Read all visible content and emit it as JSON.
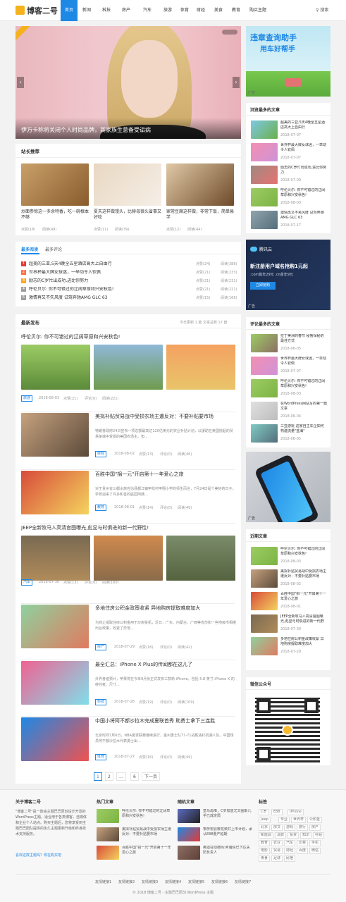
{
  "brand": {
    "name": "博客二号"
  },
  "nav": [
    "首页",
    "新闻",
    "科技",
    "房产",
    "汽车",
    "旅游",
    "体育",
    "财经",
    "美食",
    "教育",
    "购买主题"
  ],
  "search": "搜索",
  "hero": {
    "title": "伊万卡称将关闭个人时尚品牌，其家族生意备受诟病"
  },
  "ad_top": {
    "line1": "违章查询助手",
    "line2": "用车好帮手",
    "label": "广告"
  },
  "popular": {
    "title": "浏览最多的文章",
    "items": [
      {
        "t": "超美的三亚,5天4晚全五星酒店高大上自由行",
        "d": "2018-07-07"
      },
      {
        "t": "世界杯最大牌女球迷，一举动令人钦佩",
        "d": "2018-07-07"
      },
      {
        "t": "励志的C罗忙出成功,进比你努力",
        "d": "2018-07-09"
      },
      {
        "t": "呼伦贝尔: 你不可错过的辽阔草原和兴安秋色!",
        "d": "2018-08-03"
      },
      {
        "t": "激情再又不夹风度 试驾奔驰AMG GLC 63",
        "d": "2018-07-17"
      }
    ]
  },
  "recommend": {
    "title": "站长推荐",
    "items": [
      {
        "t": "炒面参惊这一多余特香，吃一碗根本不够",
        "likes": "点赞(18)",
        "views": "阅读(49)"
      },
      {
        "t": "夏天这样做馒头，比赫母很头省事又好吃",
        "likes": "点赞(11)",
        "views": "阅读(39)"
      },
      {
        "t": "家常豆腐这样做，非常下饭，简单易学",
        "likes": "点赞(12)",
        "views": "阅读(44)"
      }
    ]
  },
  "tabs": [
    "最多阅读",
    "最多评论"
  ],
  "ranklist": [
    {
      "t": "超美的三亚,5天4晚全五星酒店高大上自由行",
      "l": "点赞(24)",
      "v": "阅读(386)"
    },
    {
      "t": "世界杯最大牌女球迷，一举动令人钦佩",
      "l": "点赞(21)",
      "v": "阅读(233)"
    },
    {
      "t": "励志的C罗忙出成功,进比你努力",
      "l": "点赞(21)",
      "v": "阅读(231)"
    },
    {
      "t": "呼伦贝尔: 你不可错过的辽阔草原和兴安秋色!",
      "l": "点赞(21)",
      "v": "阅读(221)"
    },
    {
      "t": "激情再又不失风度 试驾奔驰AMG GLC 63",
      "l": "点赞(15)",
      "v": "阅读(166)"
    }
  ],
  "latest": {
    "title": "最新发布",
    "stats": "今日更新 1 篇  文章总数 17 篇"
  },
  "posts": [
    {
      "title": "呼伦贝尔: 你不可错过的辽阔草原和兴安秋色!",
      "cat": "旅游",
      "date": "2018-08-03",
      "l": "点赞(21)",
      "c": "评论(0)",
      "v": "阅读(221)"
    },
    {
      "title": "美拟补贴贸易战中受损农场主遭反对：不要补贴要市场",
      "ex": "特朗普政府24日宣布一项总额最高达120亿美元的农业补贴计划，以援助在美国挑起的贸易争端中受损的美国农场主。但...",
      "cat": "财经",
      "date": "2018-08-02",
      "l": "点赞(13)",
      "c": "评论(0)",
      "v": "阅读(46)"
    },
    {
      "title": "百胜中国\"捐一元\"开启第十一年爱心之旅",
      "ex": "对于贵州省三都水族自治县都江镇甲找村甲翔小学的师生而言，7月24日是个美好的日子。学校迎来了许多和善的庭园阿姨...",
      "cat": "教育",
      "date": "2018-08-01",
      "l": "点赞(14)",
      "c": "评论(0)",
      "v": "阅读(49)"
    },
    {
      "title": "JEEP全新牧马人高清官图曝光,彪显与时俱进的新一代野性!",
      "cat": "汽车",
      "date": "2018-07-30",
      "l": "点赞(13)",
      "c": "评论(0)",
      "v": "阅读(160)"
    },
    {
      "title": "多地住房公积金政策收紧 异地购房提取难度加大",
      "ex": "为抑止提取住房公积金用于炒房投机，近日，广东、内蒙古、广西等省份和一些地级市相继出台政策，收紧了异地...",
      "cat": "房产",
      "date": "2018-07-29",
      "l": "点赞(18)",
      "c": "评论(0)",
      "v": "阅读(42)"
    },
    {
      "title": "最全汇总：iPhone X Plus的传闻都在这儿了",
      "ex": "外界普遍预计，苹果将在今年9月份正式发布三款新 iPhone，包括 5.8 英寸 iPhone X 的继任者。尺寸...",
      "cat": "科技",
      "date": "2018-07-28",
      "l": "点赞(19)",
      "c": "评论(0)",
      "v": "阅读(109)"
    },
    {
      "title": "中国小将阿不都沙拉木完成夏联首秀 助勇士拿下三连胜",
      "ex": "北京时间7月6日，NBA夏季联赛继续进行，金州勇士队77-71战胜洛杉矶湖人队，中国球员阿不都沙拉木代表勇士出...",
      "cat": "体育",
      "date": "2018-07-27",
      "l": "点赞(16)",
      "c": "评论(0)",
      "v": "阅读(49)"
    }
  ],
  "pager": [
    "1",
    "2",
    "...",
    "6",
    "下一页"
  ],
  "ad_mid": {
    "brand": "腾讯云",
    "title": "新注册用户域名抢购1元起",
    "sub": ".com首年29元 .cn首年9元",
    "btn": "立即抢购",
    "label": "广告"
  },
  "comments": {
    "title": "评论最多的文章",
    "items": [
      {
        "t": "拉丁美洲的春节 秘鲁探秘的最佳方式",
        "d": "2018-06-05"
      },
      {
        "t": "世界杯最大牌女球迷，一举动令人钦佩",
        "d": "2018-07-07"
      },
      {
        "t": "呼伦贝尔: 你不可错过的辽阔草原和兴安秋色!",
        "d": "2018-08-03"
      },
      {
        "t": "在WordPress网站写的第一篇文章",
        "d": "2018-06-04"
      },
      {
        "t": "三亚游玩 这家自主车企如何构建流量\"蓝海\"",
        "d": "2018-06-05"
      }
    ]
  },
  "ad_phone": {
    "label": "广告"
  },
  "recent": {
    "title": "近期文章",
    "items": [
      {
        "t": "呼伦贝尔: 你不可错过的辽阔草原和兴安秋色!",
        "d": "2018-08-03"
      },
      {
        "t": "美拟补贴贸易战中受损农场主遭反对：不要补贴要市场",
        "d": "2018-08-02"
      },
      {
        "t": "百胜中国\"捐一元\"开启第十一年爱心之旅",
        "d": "2018-08-01"
      },
      {
        "t": "JEEP全新牧马人高清官图曝光,彪显与时俱进的新一代野性!",
        "d": "2018-07-30"
      },
      {
        "t": "多地住房公积金政策收紧 异地购房提取难度加大",
        "d": "2018-07-29"
      }
    ]
  },
  "wechat": {
    "title": "微信公众号"
  },
  "footer": {
    "about_title": "关于博客二号",
    "about_text": "\"博客二号\"是一款由主题巴巴原创设计开发的WordPress主题，适合用于各类博客，自媒体和企业个人站点。购买主题后，您将享受到主题巴巴团队提供的永久主题更新升级和终身技术支持服务。",
    "about_link": "喜欢这款主题吗？现在购买吧",
    "hot_title": "热门文章",
    "hot": [
      {
        "t": "呼伦贝尔: 你不可错过的辽阔草原和兴安秋色!"
      },
      {
        "t": "美拟补贴贸易战中受损农场主遭反对：不要补贴要市场"
      },
      {
        "t": "百胜中国\"捐一元\"开启第十一年爱心之旅"
      }
    ],
    "rand_title": "随机文章",
    "rand": [
      {
        "t": "皇马再降，C罗加盟尤文图斯几乎已成定局"
      },
      {
        "t": "李彦宏驳樱花荣并上市计划，承认E88量产延期"
      },
      {
        "t": "奥迪在动德尚:阿诸情已下达关防负责人"
      }
    ],
    "tags_title": "标签",
    "tags": [
      "C罗",
      "E88",
      "iPhone",
      "Jeep",
      "专业",
      "世界杯",
      "公积金",
      "北京",
      "房贷",
      "游戏",
      "旅行",
      "房产",
      "新能源",
      "消费",
      "投资",
      "知识",
      "补贴",
      "教育",
      "农业",
      "汽车",
      "比赛",
      "手机",
      "电影",
      "贸易",
      "财经",
      "百度",
      "微信",
      "美食",
      "足球",
      "民宿"
    ],
    "links": [
      "友情链接1",
      "友情链接2",
      "友情链接3",
      "友情链接4",
      "友情链接5",
      "友情链接6",
      "友情链接7"
    ],
    "copy": "© 2018 博客二号 - 主题巴巴原创 WordPress 主题"
  },
  "colors": {
    "accent": "#1e88e5",
    "brand": "#f5b21c",
    "rank": [
      "#e53935",
      "#ff7043",
      "#ffa726",
      "#9e9e9e",
      "#9e9e9e"
    ]
  }
}
